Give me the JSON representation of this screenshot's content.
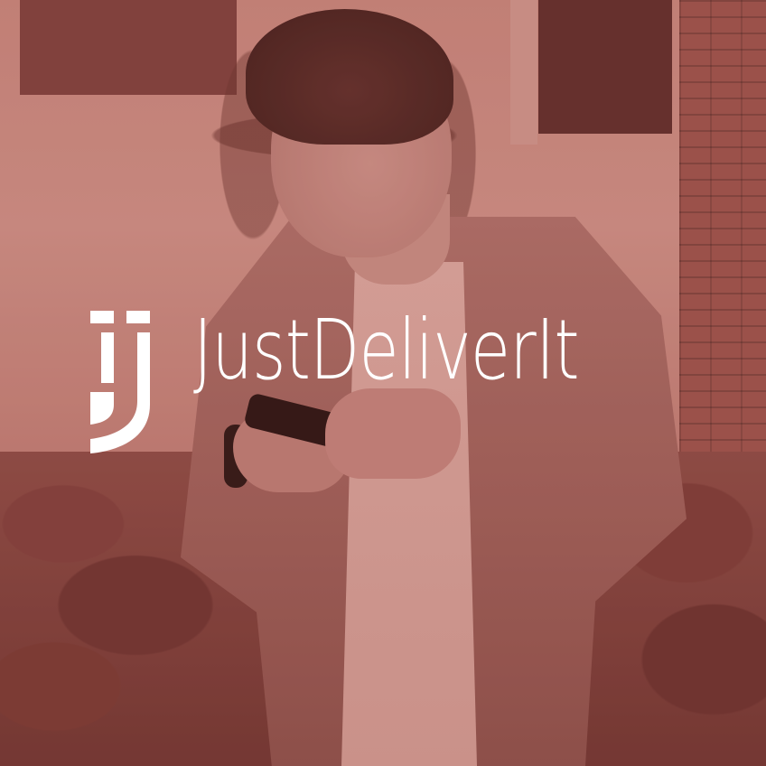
{
  "brand": {
    "name": "JustDeliverIt",
    "logo_icon": "jj-monogram-icon"
  },
  "colors": {
    "tint": "#b25c56",
    "logo": "#ffffff"
  }
}
